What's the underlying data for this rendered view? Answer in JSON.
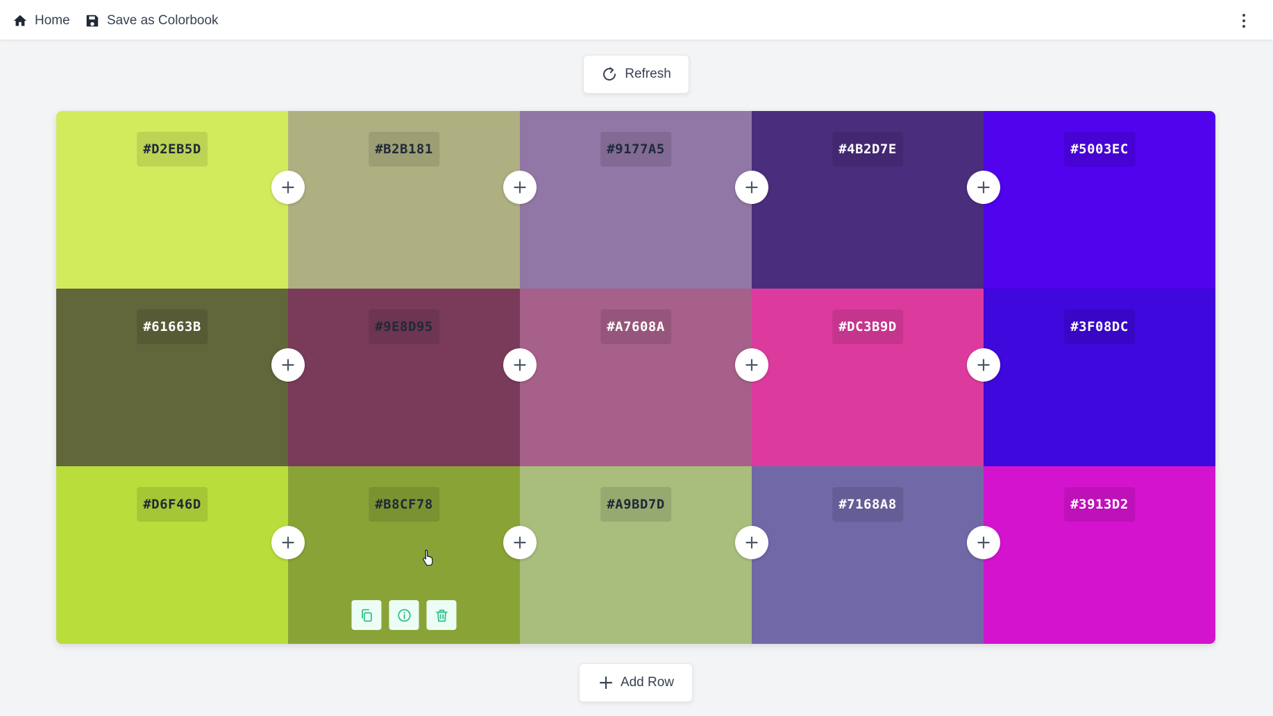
{
  "nav": {
    "home_label": "Home",
    "save_label": "Save as Colorbook"
  },
  "toolbar": {
    "refresh_label": "Refresh"
  },
  "footer": {
    "add_row_label": "Add Row"
  },
  "icons": {
    "home": "home-icon",
    "save": "floppy-disk-icon",
    "menu": "kebab-menu-icon",
    "refresh": "refresh-icon",
    "add": "plus-icon",
    "copy": "copy-icon",
    "info": "info-icon",
    "delete": "trash-icon"
  },
  "colors": {
    "action_accent": "#34c18a",
    "action_bg": "#ecfdf5"
  },
  "palette": {
    "rows": [
      [
        {
          "hex": "#D2EB5D",
          "text": "light"
        },
        {
          "hex": "#B2B181",
          "text": "light"
        },
        {
          "hex": "#9177A5",
          "text": "light"
        },
        {
          "hex": "#4B2D7E",
          "text": "dark"
        },
        {
          "hex": "#5003EC",
          "text": "dark"
        }
      ],
      [
        {
          "hex": "#61663B",
          "text": "dark"
        },
        {
          "hex": "#9E8D95",
          "text": "light"
        },
        {
          "hex": "#A7608A",
          "text": "dark"
        },
        {
          "hex": "#DC3B9D",
          "text": "dark"
        },
        {
          "hex": "#3F08DC",
          "text": "dark"
        }
      ],
      [
        {
          "hex": "#D6F46D",
          "text": "light"
        },
        {
          "hex": "#B8CF78",
          "text": "light"
        },
        {
          "hex": "#A9BD7D",
          "text": "light"
        },
        {
          "hex": "#7168A8",
          "text": "dark"
        },
        {
          "hex": "#3913D2",
          "text": "dark"
        }
      ]
    ],
    "swatch_bg": [
      [
        "#D2EB5D",
        "#AEB081",
        "#9177A5",
        "#4B2D7E",
        "#5003EC"
      ],
      [
        "#61663B",
        "#7A3B5B",
        "#A7608A",
        "#DC3B9D",
        "#3F08DC"
      ],
      [
        "#B9DD3B",
        "#8AA337",
        "#A9BD7D",
        "#7168A8",
        "#D413CF"
      ]
    ],
    "hovered_cell": {
      "row": 2,
      "col": 1
    }
  }
}
